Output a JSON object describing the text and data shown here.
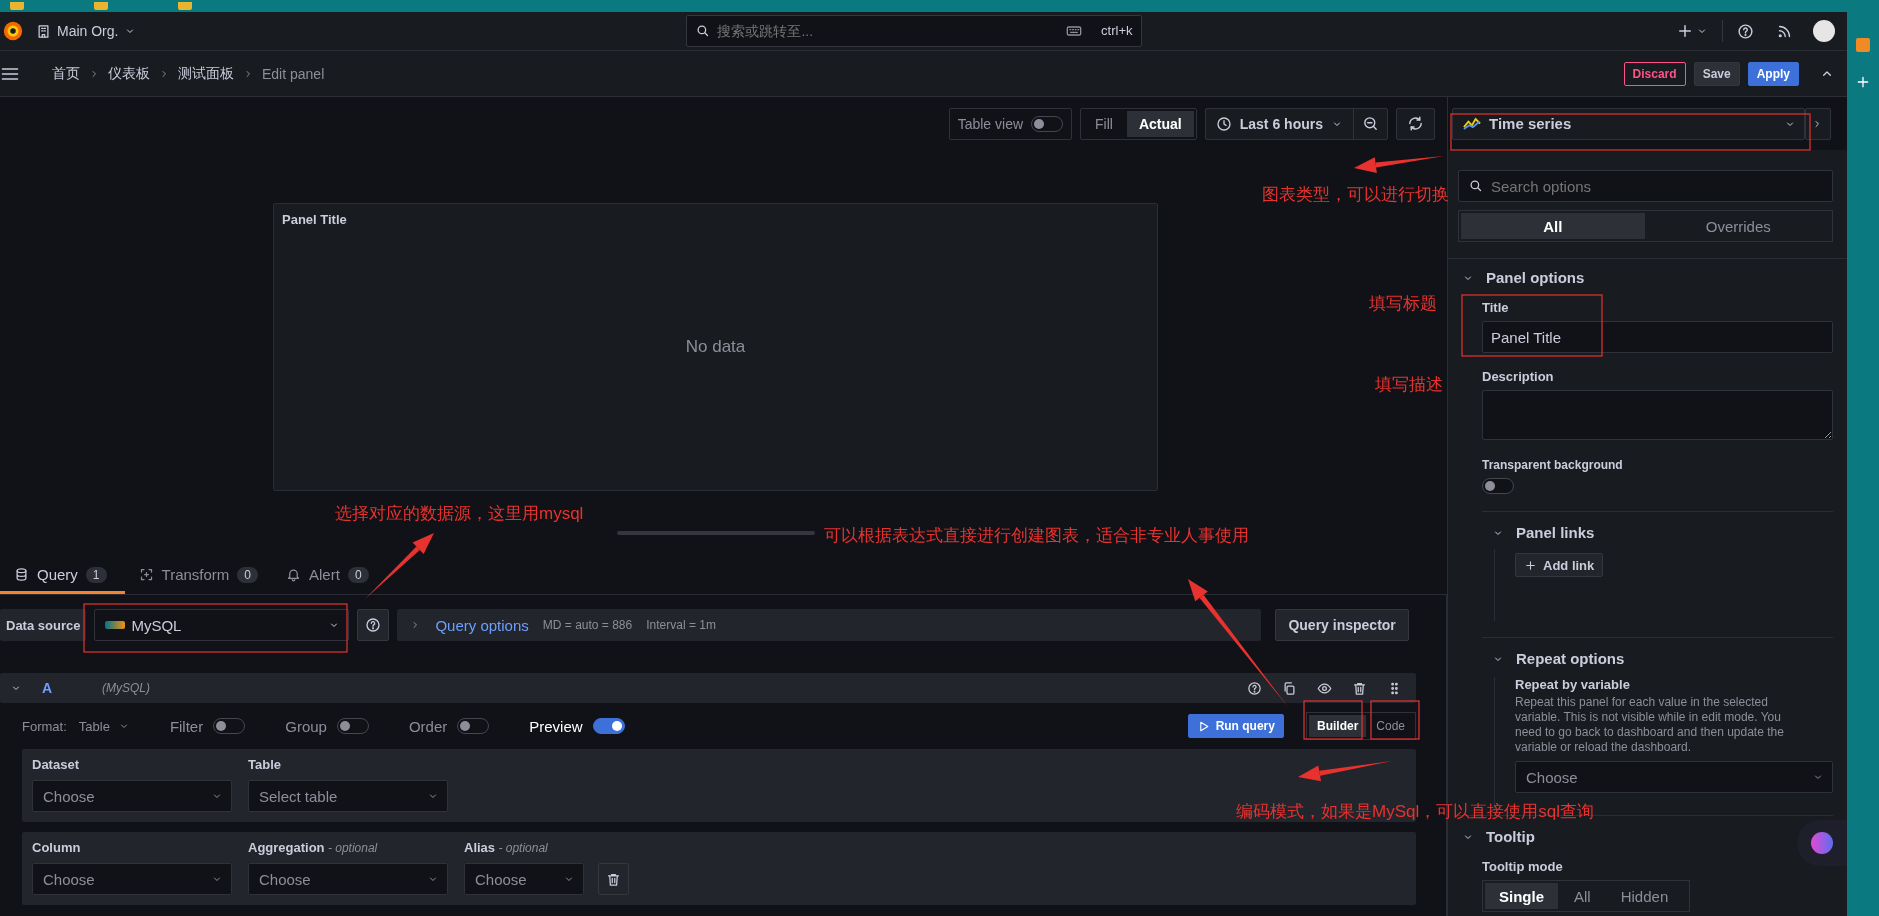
{
  "top_nav": {
    "org": "Main Org.",
    "search": {
      "placeholder": "搜索或跳转至..."
    },
    "shortcut": "ctrl+k"
  },
  "breadcrumbs": [
    "首页",
    "仪表板",
    "测试面板",
    "Edit panel"
  ],
  "actions": [
    {
      "label": "Discard",
      "kind": "danger"
    },
    {
      "label": "Save",
      "kind": "secondary"
    },
    {
      "label": "Apply",
      "kind": "primary"
    }
  ],
  "toolbar": {
    "table_view": {
      "label": "Table view",
      "on": false
    },
    "fill_modes": [
      {
        "label": "Fill",
        "selected": false
      },
      {
        "label": "Actual",
        "selected": true
      }
    ],
    "time_range": "Last 6 hours"
  },
  "panel": {
    "title": "Panel Title",
    "message": "No data"
  },
  "query_tabs": [
    {
      "label": "Query",
      "count": "1",
      "selected": true
    },
    {
      "label": "Transform",
      "count": "0",
      "selected": false
    },
    {
      "label": "Alert",
      "count": "0",
      "selected": false
    }
  ],
  "data_source": {
    "label": "Data source",
    "value": "MySQL"
  },
  "query_options": {
    "label": "Query options",
    "md": "MD = auto = 886",
    "interval": "Interval = 1m"
  },
  "query_inspector": "Query inspector",
  "query": {
    "ref": "A",
    "source": "(MySQL)",
    "format_label": "Format:",
    "format": "Table",
    "toggles": [
      {
        "label": "Filter",
        "on": false
      },
      {
        "label": "Group",
        "on": false
      },
      {
        "label": "Order",
        "on": false
      },
      {
        "label": "Preview",
        "on": true
      }
    ],
    "run": "Run query",
    "modes": [
      {
        "label": "Builder",
        "selected": true
      },
      {
        "label": "Code",
        "selected": false
      }
    ],
    "field_rows": [
      [
        {
          "label": "Dataset",
          "placeholder": "Choose"
        },
        {
          "label": "Table",
          "placeholder": "Select table"
        }
      ],
      [
        {
          "label": "Column",
          "placeholder": "Choose"
        },
        {
          "label": "Aggregation",
          "hint": "- optional",
          "placeholder": "Choose"
        },
        {
          "label": "Alias",
          "hint": "- optional",
          "placeholder": "Choose"
        }
      ]
    ]
  },
  "options": {
    "visualization": "Time series",
    "search": {
      "placeholder": "Search options"
    },
    "tabs": [
      {
        "label": "All",
        "selected": true
      },
      {
        "label": "Overrides",
        "selected": false
      }
    ],
    "panel_options": {
      "title": "Panel options",
      "expanded": true,
      "title_label": "Title",
      "title_value": "Panel Title",
      "description_label": "Description",
      "transparent_label": "Transparent background",
      "transparent": false
    },
    "panel_links": {
      "title": "Panel links",
      "expanded": true,
      "add": "Add link"
    },
    "repeat_options": {
      "title": "Repeat options",
      "expanded": true,
      "label": "Repeat by variable",
      "description": "Repeat this panel for each value in the selected variable. This is not visible while in edit mode. You need to go back to dashboard and then update the variable or reload the dashboard.",
      "placeholder": "Choose"
    },
    "tooltip": {
      "title": "Tooltip",
      "expanded": true,
      "mode_label": "Tooltip mode",
      "modes": [
        {
          "label": "Single",
          "selected": true
        },
        {
          "label": "All",
          "selected": false
        },
        {
          "label": "Hidden",
          "selected": false
        }
      ]
    }
  },
  "annotations": [
    {
      "text": "图表类型，可以进行切换"
    },
    {
      "text": "填写标题"
    },
    {
      "text": "填写描述"
    },
    {
      "text": "选择对应的数据源，这里用mysql"
    },
    {
      "text": "可以根据表达式直接进行创建图表，适合非专业人事使用"
    },
    {
      "text": "编码模式，如果是MySql，可以直接使用sql查询"
    }
  ]
}
